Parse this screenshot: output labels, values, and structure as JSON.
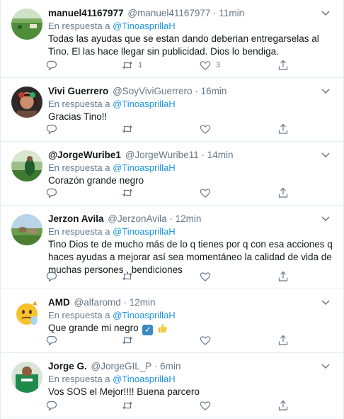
{
  "reply_prefix": "En respuesta a",
  "tweets": [
    {
      "name": "manuel41167977",
      "handle": "@manuel41167977",
      "time": "11min",
      "reply_to": "@TinoasprillaH",
      "text": "Todas las ayudas que se estan dando deberian  entregarselas al Tino. El las hace llegar sin publicidad. Dios lo bendiga.",
      "retweets": "1",
      "likes": "3",
      "avatar": "green-field-photo"
    },
    {
      "name": "Vivi Guerrero",
      "handle": "@SoyViviGuerrero",
      "time": "16min",
      "reply_to": "@TinoasprillaH",
      "text": "Gracias Tino!!",
      "retweets": "",
      "likes": "",
      "avatar": "woman-portrait-photo"
    },
    {
      "name": "@JorgeWuribe1",
      "handle": "@JorgeWuribe11",
      "time": "14min",
      "reply_to": "@TinoasprillaH",
      "text": "Corazón grande negro",
      "retweets": "",
      "likes": "",
      "avatar": "outdoor-green-photo"
    },
    {
      "name": "Jerzon Avila",
      "handle": "@JerzonAvila",
      "time": "12min",
      "reply_to": "@TinoasprillaH",
      "text": "Tino Dios te de mucho más de lo q tienes por q con esa acciones q haces ayudas a mejorar así sea momentáneo la calidad de vida de muchas persones , bendiciones",
      "retweets": "",
      "likes": "",
      "avatar": "field-landscape-photo"
    },
    {
      "name": "AMD",
      "handle": "@alfaromd",
      "time": "12min",
      "reply_to": "@TinoasprillaH",
      "text": "Que grande mi negro",
      "emoji_check": "✓",
      "retweets": "",
      "likes": "",
      "avatar": "emoji-face-avatar"
    },
    {
      "name": "Jorge G.",
      "handle": "@JorgeGIL_P",
      "time": "6min",
      "reply_to": "@TinoasprillaH",
      "text": "Vos SOS el Mejor!!!! Buena parcero",
      "retweets": "",
      "likes": "",
      "avatar": "green-jersey-photo"
    }
  ],
  "colors": {
    "accent": "#1b95e0",
    "secondary_text": "#657786",
    "border": "#e6ecf0"
  }
}
